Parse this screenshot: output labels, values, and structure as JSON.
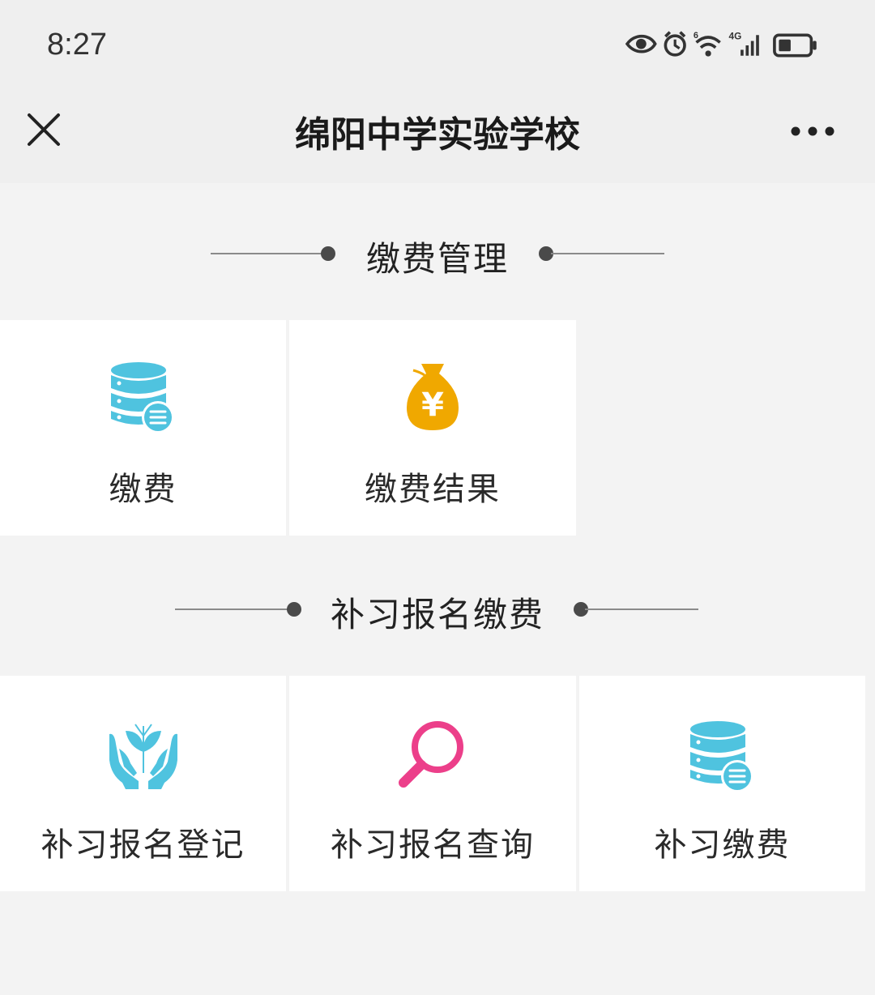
{
  "status": {
    "time": "8:27",
    "icons": [
      "eye-icon",
      "alarm-icon",
      "wifi-icon",
      "signal-4g-icon",
      "battery-icon"
    ],
    "network_label": "4G",
    "wifi_label": "6"
  },
  "nav": {
    "title": "绵阳中学实验学校",
    "close_icon": "close-icon",
    "more_icon": "more-icon"
  },
  "sections": [
    {
      "title": "缴费管理",
      "tiles": [
        {
          "label": "缴费",
          "icon": "database-list-icon",
          "icon_color": "#4fc3df"
        },
        {
          "label": "缴费结果",
          "icon": "money-bag-yen-icon",
          "icon_color": "#f0a800",
          "icon_text": "¥"
        }
      ]
    },
    {
      "title": "补习报名缴费",
      "tiles": [
        {
          "label": "补习报名登记",
          "icon": "hands-plant-icon",
          "icon_color": "#4fc3df"
        },
        {
          "label": "补习报名查询",
          "icon": "search-icon",
          "icon_color": "#ec3f8a"
        },
        {
          "label": "补习缴费",
          "icon": "database-list-icon",
          "icon_color": "#4fc3df"
        }
      ]
    }
  ]
}
